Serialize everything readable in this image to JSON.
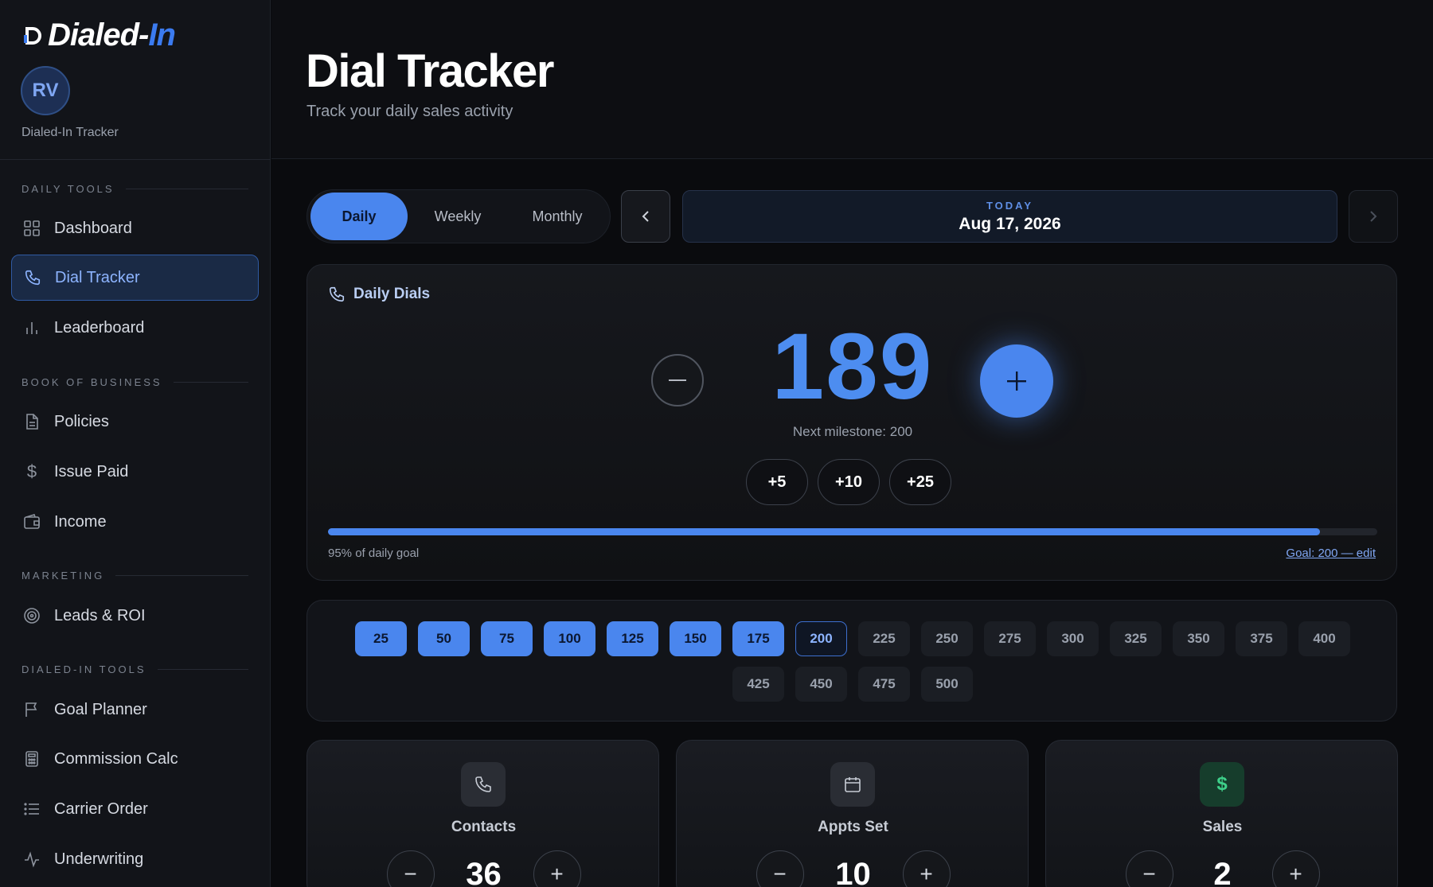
{
  "brand": {
    "name_main": "Dialed-",
    "name_accent": "In"
  },
  "user": {
    "initials": "RV",
    "subtitle": "Dialed-In Tracker"
  },
  "sidebar": {
    "sections": [
      {
        "label": "DAILY TOOLS"
      },
      {
        "label": "BOOK OF BUSINESS"
      },
      {
        "label": "MARKETING"
      },
      {
        "label": "DIALED-IN TOOLS"
      }
    ],
    "items": [
      {
        "label": "Dashboard",
        "icon": "grid-icon"
      },
      {
        "label": "Dial Tracker",
        "icon": "phone-icon",
        "active": true
      },
      {
        "label": "Leaderboard",
        "icon": "bar-chart-icon"
      },
      {
        "label": "Policies",
        "icon": "document-icon"
      },
      {
        "label": "Issue Paid",
        "icon": "dollar-icon"
      },
      {
        "label": "Income",
        "icon": "wallet-icon"
      },
      {
        "label": "Leads & ROI",
        "icon": "target-icon"
      },
      {
        "label": "Goal Planner",
        "icon": "flag-icon"
      },
      {
        "label": "Commission Calc",
        "icon": "calculator-icon"
      },
      {
        "label": "Carrier Order",
        "icon": "list-icon"
      },
      {
        "label": "Underwriting",
        "icon": "activity-icon"
      }
    ]
  },
  "header": {
    "title": "Dial Tracker",
    "subtitle": "Track your daily sales activity"
  },
  "period_tabs": [
    "Daily",
    "Weekly",
    "Monthly"
  ],
  "date_nav": {
    "label": "TODAY",
    "value": "Aug 17, 2026"
  },
  "dials": {
    "title": "Daily Dials",
    "count": "189",
    "milestone_text": "Next milestone: 200",
    "quick_add": [
      "+5",
      "+10",
      "+25"
    ],
    "progress_fraction": 0.945,
    "progress_label": "95% of daily goal",
    "goal_label": "Goal: 200 — edit"
  },
  "milestones": {
    "row1": [
      "25",
      "50",
      "75",
      "100",
      "125",
      "150",
      "175",
      "200",
      "225",
      "250",
      "275",
      "300",
      "325",
      "350",
      "375",
      "400"
    ],
    "row2": [
      "425",
      "450",
      "475",
      "500"
    ],
    "completed_count": 7,
    "next_value": "200"
  },
  "stats": [
    {
      "label": "Contacts",
      "value": "36",
      "icon": "phone-icon"
    },
    {
      "label": "Appts Set",
      "value": "10",
      "icon": "calendar-icon"
    },
    {
      "label": "Sales",
      "value": "2",
      "icon": "dollar-icon"
    }
  ],
  "colors": {
    "accent": "#4a86ee",
    "background": "#0a0b0e",
    "sales_green": "#3ed08a"
  }
}
